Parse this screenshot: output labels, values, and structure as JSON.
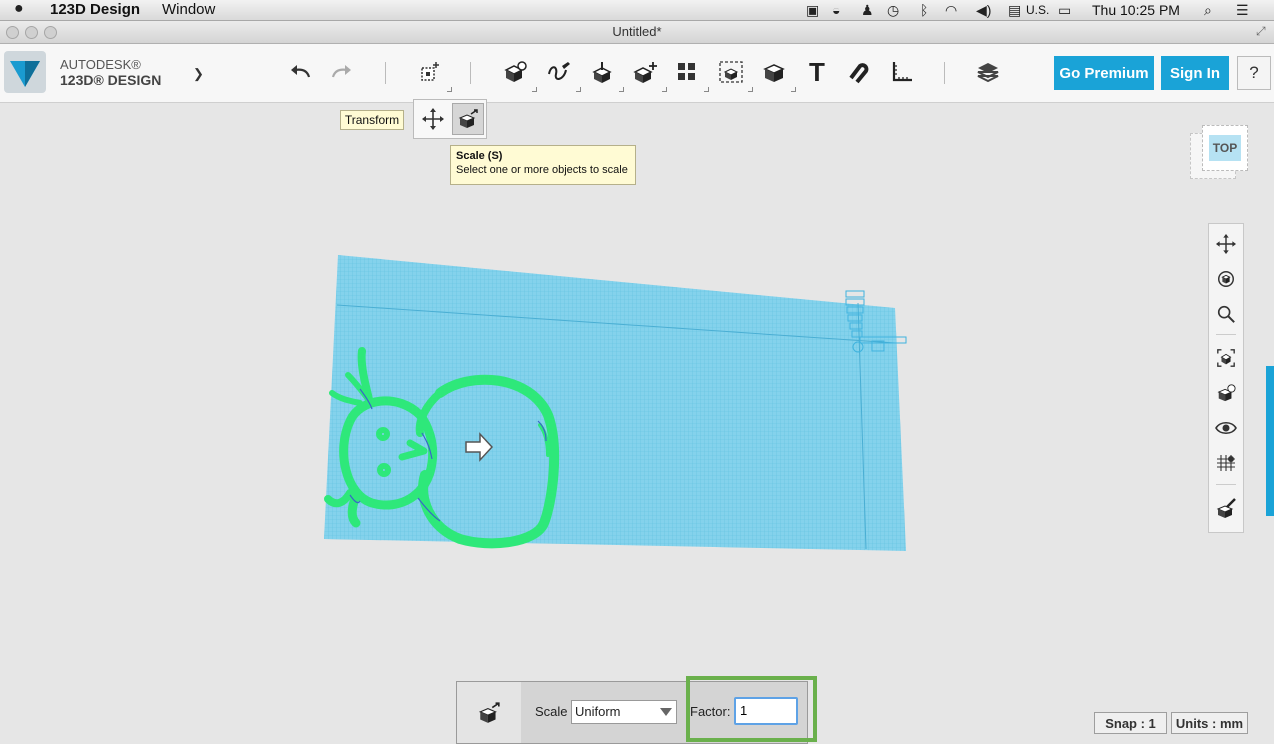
{
  "menubar": {
    "app_name": "123D Design",
    "window_menu": "Window",
    "input_source": "U.S.",
    "clock": "Thu 10:25 PM"
  },
  "window": {
    "title": "Untitled*"
  },
  "brand": {
    "line1": "AUTODESK®",
    "line2": "123D® DESIGN"
  },
  "toolbar": {
    "go_premium": "Go Premium",
    "sign_in": "Sign In",
    "help": "?"
  },
  "transform_popup": {
    "label": "Transform",
    "tooltip_title": "Scale (S)",
    "tooltip_desc": "Select one or more objects to scale"
  },
  "viewcube": {
    "face_label": "TOP"
  },
  "scale_panel": {
    "scale_label": "Scale",
    "mode_value": "Uniform",
    "factor_label": "Factor:",
    "factor_value": "1"
  },
  "status": {
    "snap": "Snap : 1",
    "units": "Units : mm"
  },
  "colors": {
    "accent": "#1aa3d7",
    "grid_fill": "#7fd0ea",
    "sketch": "#2ee87a",
    "highlight_box": "#6ab04c"
  }
}
